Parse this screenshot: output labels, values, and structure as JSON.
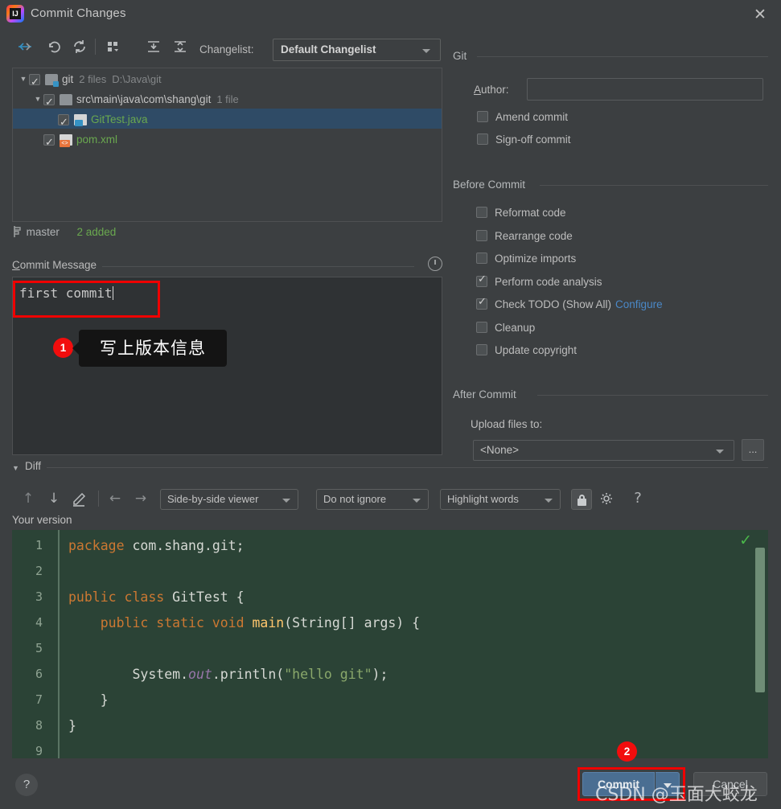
{
  "window": {
    "title": "Commit Changes",
    "app_icon": "intellij-idea-icon",
    "close_label": "✕"
  },
  "toolbar": {
    "icons": [
      {
        "name": "show-diff-icon",
        "glyph": "diff"
      },
      {
        "name": "revert-icon",
        "glyph": "undo"
      },
      {
        "name": "refresh-icon",
        "glyph": "refresh"
      },
      {
        "name": "group-by-icon",
        "glyph": "group"
      },
      {
        "name": "expand-all-icon",
        "glyph": "expand"
      },
      {
        "name": "collapse-all-icon",
        "glyph": "collapse"
      }
    ],
    "changelist_label": "Changelist:",
    "changelist_value": "Default Changelist"
  },
  "tree": {
    "rows": [
      {
        "indent": 0,
        "twisty": "▼",
        "checked": true,
        "icon": "folder-vcs-icon",
        "name": "git",
        "name_style": "plain",
        "meta": "2 files",
        "meta2": "D:\\Java\\git",
        "selected": false
      },
      {
        "indent": 1,
        "twisty": "▼",
        "checked": true,
        "icon": "folder-icon",
        "name": "src\\main\\java\\com\\shang\\git",
        "name_style": "plain",
        "meta": "1 file",
        "meta2": "",
        "selected": false
      },
      {
        "indent": 2,
        "twisty": "",
        "checked": true,
        "icon": "java-file-icon",
        "name": "GitTest.java",
        "name_style": "added",
        "meta": "",
        "meta2": "",
        "selected": true
      },
      {
        "indent": 1,
        "twisty": "",
        "checked": true,
        "icon": "xml-file-icon",
        "name": "pom.xml",
        "name_style": "added",
        "meta": "",
        "meta2": "",
        "selected": false
      }
    ]
  },
  "branch": {
    "icon": "branch-icon",
    "name": "master",
    "added": "2 added"
  },
  "commit_message": {
    "section_label": "Commit Message",
    "history_icon": "clock-history-icon",
    "value": "first commit",
    "placeholder": ""
  },
  "options": {
    "git_group": "Git",
    "author_label": "Author:",
    "author_value": "",
    "git_checks": [
      {
        "name": "amend-commit",
        "label": "Amend commit",
        "checked": false
      },
      {
        "name": "sign-off-commit",
        "label": "Sign-off commit",
        "checked": false
      }
    ],
    "before_commit_group": "Before Commit",
    "before_checks": [
      {
        "name": "reformat-code",
        "label": "Reformat code",
        "checked": false,
        "link": ""
      },
      {
        "name": "rearrange-code",
        "label": "Rearrange code",
        "checked": false,
        "link": ""
      },
      {
        "name": "optimize-imports",
        "label": "Optimize imports",
        "checked": false,
        "link": ""
      },
      {
        "name": "perform-code-analysis",
        "label": "Perform code analysis",
        "checked": true,
        "link": ""
      },
      {
        "name": "check-todo",
        "label": "Check TODO (Show All)",
        "checked": true,
        "link": "Configure"
      },
      {
        "name": "cleanup",
        "label": "Cleanup",
        "checked": false,
        "link": ""
      },
      {
        "name": "update-copyright",
        "label": "Update copyright",
        "checked": false,
        "link": ""
      }
    ],
    "after_commit_group": "After Commit",
    "upload_label": "Upload files to:",
    "upload_value": "<None>",
    "upload_browse": "..."
  },
  "diff": {
    "section_label": "Diff",
    "twisty": "▼",
    "toolbar_icons": [
      {
        "name": "previous-difference-icon",
        "glyph": "↑"
      },
      {
        "name": "next-difference-icon",
        "glyph": "↓"
      },
      {
        "name": "edit-source-icon",
        "glyph": "✎"
      },
      {
        "name": "accept-left-icon",
        "glyph": "←"
      },
      {
        "name": "accept-right-icon",
        "glyph": "→"
      }
    ],
    "viewer_mode": "Side-by-side viewer",
    "ignore_mode": "Do not ignore",
    "highlight_mode": "Highlight words",
    "lock_icon": "lock-icon",
    "settings_icon": "gear-icon",
    "help_icon": "question-mark-icon",
    "pane_title": "Your version",
    "status_icon": "green-check-icon",
    "lines": [
      {
        "n": 1,
        "tokens": [
          {
            "t": "package",
            "c": "kw"
          },
          {
            "t": " com.shang.git;",
            "c": "pl"
          }
        ]
      },
      {
        "n": 2,
        "tokens": []
      },
      {
        "n": 3,
        "tokens": [
          {
            "t": "public class",
            "c": "kw"
          },
          {
            "t": " GitTest {",
            "c": "pl"
          }
        ]
      },
      {
        "n": 4,
        "tokens": [
          {
            "t": "    public static void",
            "c": "kw"
          },
          {
            "t": " ",
            "c": "pl"
          },
          {
            "t": "main",
            "c": "fn"
          },
          {
            "t": "(String[] args) {",
            "c": "pl"
          }
        ]
      },
      {
        "n": 5,
        "tokens": []
      },
      {
        "n": 6,
        "tokens": [
          {
            "t": "        System.",
            "c": "pl"
          },
          {
            "t": "out",
            "c": "fld"
          },
          {
            "t": ".println(",
            "c": "pl"
          },
          {
            "t": "\"hello git\"",
            "c": "str"
          },
          {
            "t": ");",
            "c": "pl"
          }
        ]
      },
      {
        "n": 7,
        "tokens": [
          {
            "t": "    }",
            "c": "pl"
          }
        ]
      },
      {
        "n": 8,
        "tokens": [
          {
            "t": "}",
            "c": "pl"
          }
        ]
      },
      {
        "n": 9,
        "tokens": []
      }
    ]
  },
  "footer": {
    "help_label": "?",
    "commit_label": "Commit",
    "commit_dropdown_icon": "chevron-down-icon",
    "cancel_label": "Cancel"
  },
  "annotations": [
    {
      "badge": "1",
      "text": "写上版本信息"
    },
    {
      "badge": "2",
      "text": ""
    }
  ],
  "watermark": "CSDN @玉面大蛟龙",
  "colors": {
    "dialog_bg": "#3c3f41",
    "panel_bg": "#2f3234",
    "accent_blue": "#4a88c7",
    "button_blue": "#4a6e92",
    "added_green": "#6aa84f",
    "annotation_red": "#ef0000",
    "selection_blue": "#2f4b66",
    "diff_bg": "#2b4336"
  }
}
